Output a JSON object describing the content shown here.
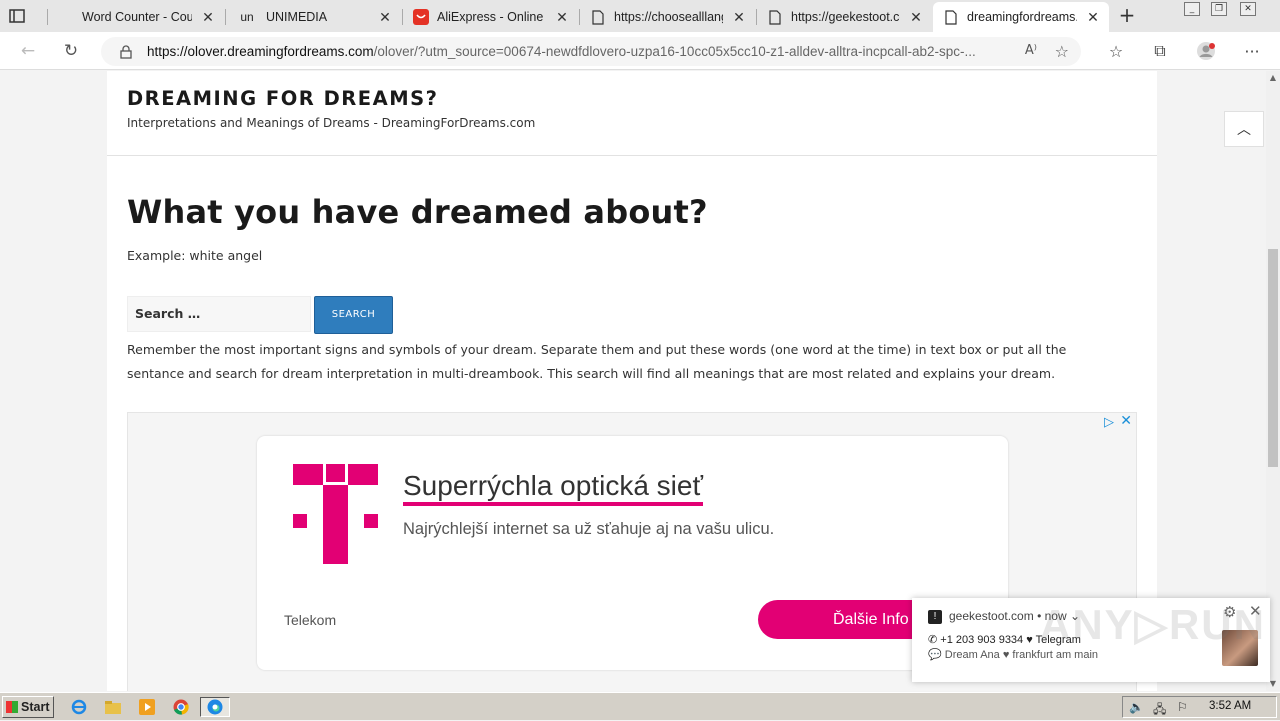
{
  "browser": {
    "tabs": [
      {
        "title": "Word Counter - Cour",
        "icon": "page-icon"
      },
      {
        "title": "UNIMEDIA",
        "icon": "unimedia-icon",
        "icon_text": "un"
      },
      {
        "title": "AliExpress - Online Sh",
        "icon": "aliexpress-icon"
      },
      {
        "title": "https://choosealllang",
        "icon": "page-icon"
      },
      {
        "title": "https://geekestoot.cc",
        "icon": "page-icon"
      },
      {
        "title": "dreamingfordreams.c",
        "icon": "page-icon",
        "active": true
      }
    ],
    "url_host": "https://olover.dreamingfordreams.com",
    "url_rest": "/olover/?utm_source=00674-newdfdlovero-uzpa16-10cc05x5cc10-z1-alldev-alltra-incpcall-ab2-spc-..."
  },
  "site": {
    "title": "DREAMING FOR DREAMS?",
    "description": "Interpretations and Meanings of Dreams - DreamingForDreams.com"
  },
  "main": {
    "heading": "What you have dreamed about?",
    "example": "Example: white angel",
    "search_placeholder": "Search …",
    "search_button": "Search",
    "instructions": "Remember the most important signs and symbols of your dream. Separate them and put these words (one word at the time) in text box or put all the sentance and search for dream interpretation in multi-dreambook. This search will find all meanings that are most related and explains your dream."
  },
  "ad": {
    "headline": "Superrýchla optická sieť",
    "subline": "Najrýchlejší internet sa už sťahuje aj na vašu ulicu.",
    "brand": "Telekom",
    "cta": "Ďalšie Info",
    "accent_color": "#e20074"
  },
  "notification": {
    "source": "geekestoot.com",
    "time": "• now",
    "line1": "+1 203 903 9334 ♥ Telegram",
    "line2": "Dream Ana ♥ frankfurt am main"
  },
  "taskbar": {
    "start_label": "Start",
    "clock": "3:52 AM"
  }
}
